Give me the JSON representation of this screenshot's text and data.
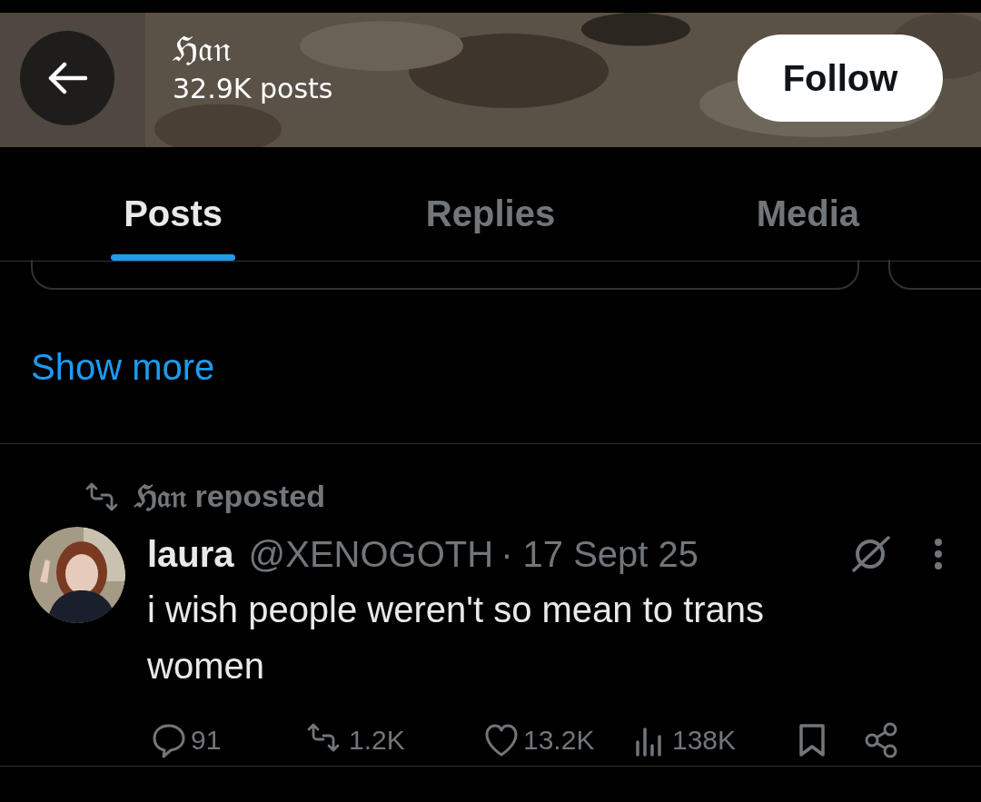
{
  "header": {
    "name": "ℌ𝔞𝔫",
    "post_count": "32.9K posts",
    "follow_label": "Follow"
  },
  "tabs": [
    {
      "label": "Posts",
      "selected": true
    },
    {
      "label": "Replies",
      "selected": false
    },
    {
      "label": "Media",
      "selected": false
    }
  ],
  "show_more": "Show more",
  "post": {
    "repost_by": "ℌ𝔞𝔫",
    "repost_text": "reposted",
    "author": "laura",
    "handle": "@XENOGOTH",
    "date": "· 17 Sept 25",
    "text": "i wish people weren't so mean to trans women",
    "actions": [
      {
        "kind": "reply",
        "count": "91"
      },
      {
        "kind": "repost",
        "count": "1.2K"
      },
      {
        "kind": "like",
        "count": "13.2K"
      },
      {
        "kind": "views",
        "count": "138K"
      },
      {
        "kind": "bookmark"
      },
      {
        "kind": "share"
      }
    ]
  }
}
